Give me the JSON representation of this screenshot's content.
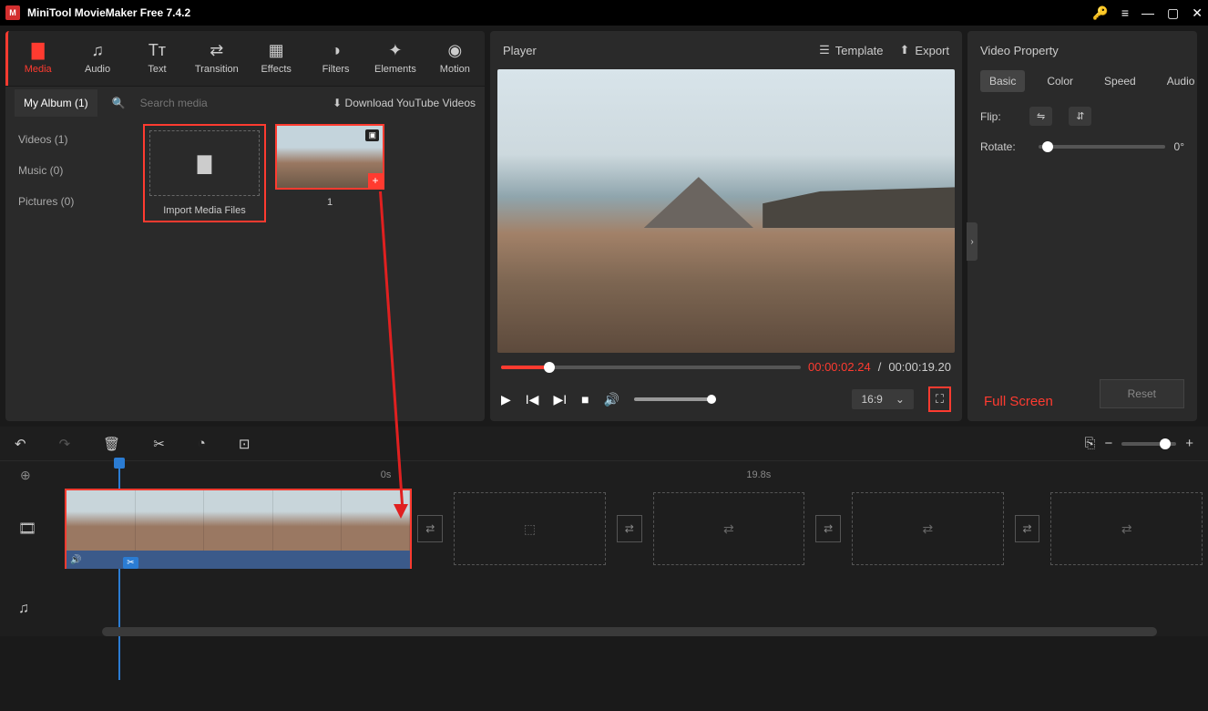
{
  "app": {
    "title": "MiniTool MovieMaker Free 7.4.2"
  },
  "ribbon": [
    {
      "label": "Media",
      "icon": "📂"
    },
    {
      "label": "Audio",
      "icon": "♫"
    },
    {
      "label": "Text",
      "icon": "T𝚃"
    },
    {
      "label": "Transition",
      "icon": "⇄"
    },
    {
      "label": "Effects",
      "icon": "▦"
    },
    {
      "label": "Filters",
      "icon": "◑"
    },
    {
      "label": "Elements",
      "icon": "✦"
    },
    {
      "label": "Motion",
      "icon": "◉"
    }
  ],
  "media": {
    "albumLabel": "My Album (1)",
    "searchPlaceholder": "Search media",
    "downloadLabel": "Download YouTube Videos",
    "side": [
      {
        "label": "Videos (1)"
      },
      {
        "label": "Music (0)"
      },
      {
        "label": "Pictures (0)"
      }
    ],
    "importLabel": "Import Media Files",
    "clipLabel": "1"
  },
  "player": {
    "title": "Player",
    "template": "Template",
    "export": "Export",
    "currentTime": "00:00:02.24",
    "duration": "00:00:19.20",
    "aspect": "16:9",
    "fullscreenAnnotation": "Full Screen"
  },
  "prop": {
    "title": "Video Property",
    "tabs": [
      "Basic",
      "Color",
      "Speed",
      "Audio"
    ],
    "flipLabel": "Flip:",
    "rotateLabel": "Rotate:",
    "rotateValue": "0°",
    "reset": "Reset"
  },
  "timeline": {
    "ruler": [
      "0s",
      "19.8s"
    ]
  }
}
